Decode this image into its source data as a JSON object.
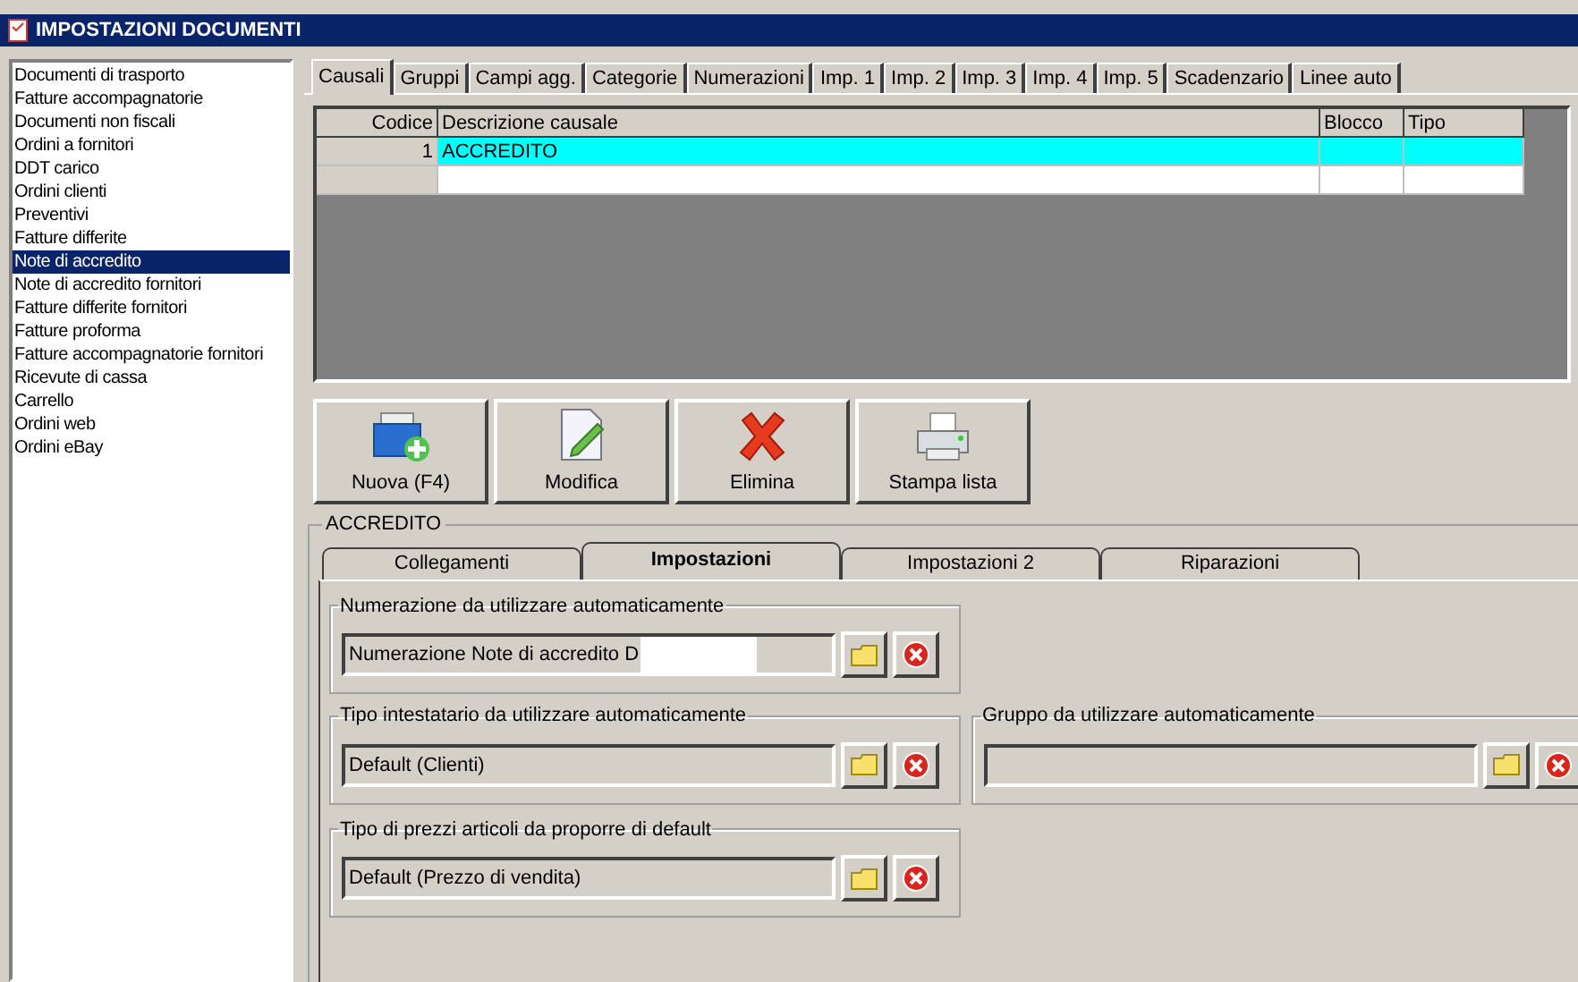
{
  "window": {
    "title": "IMPOSTAZIONI DOCUMENTI"
  },
  "document_types": [
    {
      "label": "Documenti di trasporto",
      "selected": false
    },
    {
      "label": "Fatture accompagnatorie",
      "selected": false
    },
    {
      "label": "Documenti non fiscali",
      "selected": false
    },
    {
      "label": "Ordini a fornitori",
      "selected": false
    },
    {
      "label": "DDT carico",
      "selected": false
    },
    {
      "label": "Ordini clienti",
      "selected": false
    },
    {
      "label": "Preventivi",
      "selected": false
    },
    {
      "label": "Fatture differite",
      "selected": false
    },
    {
      "label": "Note di accredito",
      "selected": true
    },
    {
      "label": "Note di accredito fornitori",
      "selected": false
    },
    {
      "label": "Fatture differite fornitori",
      "selected": false
    },
    {
      "label": "Fatture proforma",
      "selected": false
    },
    {
      "label": "Fatture accompagnatorie fornitori",
      "selected": false
    },
    {
      "label": "Ricevute di cassa",
      "selected": false
    },
    {
      "label": "Carrello",
      "selected": false
    },
    {
      "label": "Ordini web",
      "selected": false
    },
    {
      "label": "Ordini eBay",
      "selected": false
    }
  ],
  "tabs": [
    {
      "label": "Causali",
      "selected": true
    },
    {
      "label": "Gruppi",
      "selected": false
    },
    {
      "label": "Campi agg.",
      "selected": false
    },
    {
      "label": "Categorie",
      "selected": false
    },
    {
      "label": "Numerazioni",
      "selected": false
    },
    {
      "label": "Imp. 1",
      "selected": false
    },
    {
      "label": "Imp. 2",
      "selected": false
    },
    {
      "label": "Imp. 3",
      "selected": false
    },
    {
      "label": "Imp. 4",
      "selected": false
    },
    {
      "label": "Imp. 5",
      "selected": false
    },
    {
      "label": "Scadenzario",
      "selected": false
    },
    {
      "label": "Linee auto",
      "selected": false
    }
  ],
  "table": {
    "columns": [
      "Codice",
      "Descrizione causale",
      "Blocco",
      "Tipo"
    ],
    "rows": [
      {
        "cells": [
          "1",
          "ACCREDITO",
          "",
          ""
        ],
        "selected": true
      },
      {
        "cells": [
          "",
          "",
          "",
          ""
        ],
        "selected": false
      }
    ]
  },
  "toolbar": [
    {
      "kind": "new",
      "label": "Nuova (F4)"
    },
    {
      "kind": "edit",
      "label": "Modifica"
    },
    {
      "kind": "delete",
      "label": "Elimina"
    },
    {
      "kind": "print",
      "label": "Stampa lista"
    }
  ],
  "detail": {
    "title": "ACCREDITO",
    "tabs": [
      {
        "label": "Collegamenti",
        "selected": false
      },
      {
        "label": "Impostazioni",
        "selected": true
      },
      {
        "label": "Impostazioni 2",
        "selected": false
      },
      {
        "label": "Riparazioni",
        "selected": false
      }
    ],
    "groups": [
      {
        "label": "Numerazione da utilizzare automaticamente",
        "value": "Numerazione Note di accredito D",
        "redacted": true
      },
      {
        "label": "Tipo intestatario da utilizzare automaticamente",
        "value": "Default (Clienti)",
        "redacted": false
      },
      {
        "label": "Gruppo da utilizzare automaticamente",
        "redacted": false
      },
      {
        "label": "Tipo di prezzi articoli da proporre di default",
        "value": "Default (Prezzo di vendita)",
        "redacted": false
      }
    ]
  }
}
